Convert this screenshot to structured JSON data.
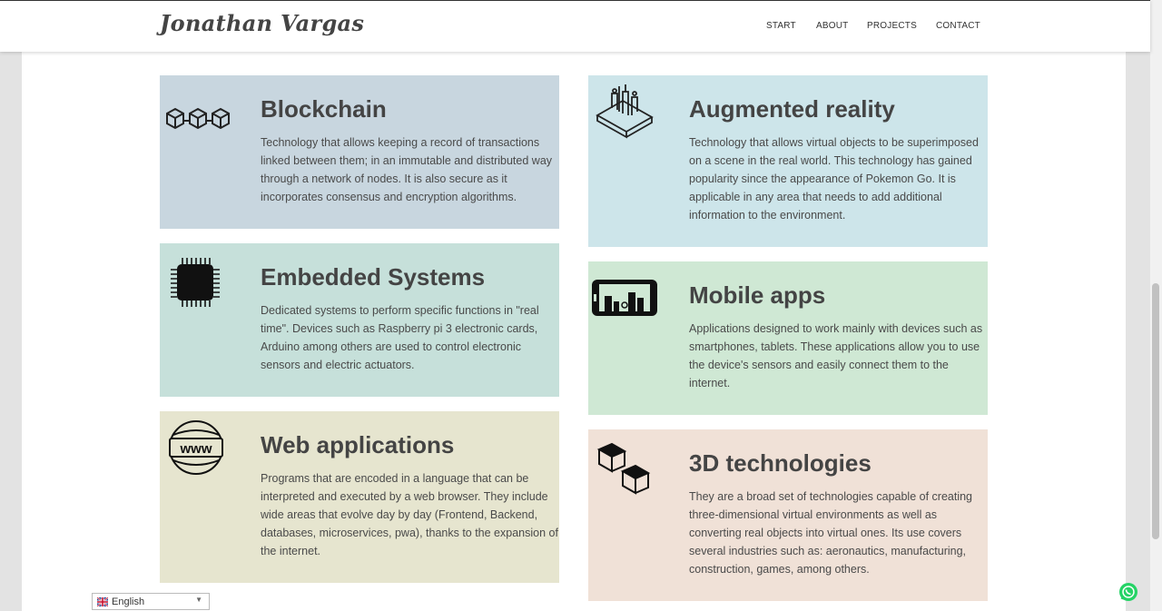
{
  "header": {
    "brand": "Jonathan Vargas",
    "nav": [
      "START",
      "ABOUT",
      "PROJECTS",
      "CONTACT"
    ]
  },
  "cards": [
    {
      "icon": "blockchain-icon",
      "color": "#c8d6df",
      "title": "Blockchain",
      "text": "Technology that allows keeping a record of transactions linked between them; in an immutable and distributed way through a network of nodes. It is also secure as it incorporates consensus and encryption algorithms."
    },
    {
      "icon": "augmented-reality-icon",
      "color": "#cde5ea",
      "title": "Augmented reality",
      "text": "Technology that allows virtual objects to be superimposed on a scene in the real world. This technology has gained popularity since the appearance of Pokemon Go. It is applicable in any area that needs to add additional information to the environment."
    },
    {
      "icon": "chip-icon",
      "color": "#c6e0da",
      "title": "Embedded Systems",
      "text": "Dedicated systems to perform specific functions in \"real time\". Devices such as Raspberry pi 3 electronic cards, Arduino among others are used to control electronic sensors and electric actuators."
    },
    {
      "icon": "mobile-app-icon",
      "color": "#cfe8d4",
      "title": "Mobile apps",
      "text": "Applications designed to work mainly with devices such as smartphones, tablets. These applications allow you to use the device's sensors and easily connect them to the internet."
    },
    {
      "icon": "www-globe-icon",
      "color": "#e6e5cf",
      "title": "Web applications",
      "text": "Programs that are encoded in a language that can be interpreted and executed by a web browser. They include wide areas that evolve day by day (Frontend, Backend, databases, microservices, pwa), thanks to the expansion of the internet."
    },
    {
      "icon": "3d-cubes-icon",
      "color": "#f0e1d7",
      "title": "3D technologies",
      "text": "They are a broad set of technologies capable of creating three-dimensional virtual environments as well as converting real objects into virtual ones. Its use covers several industries such as: aeronautics, manufacturing, construction, games, among others."
    }
  ],
  "language_selector": {
    "value": "English",
    "caret": "▼"
  }
}
